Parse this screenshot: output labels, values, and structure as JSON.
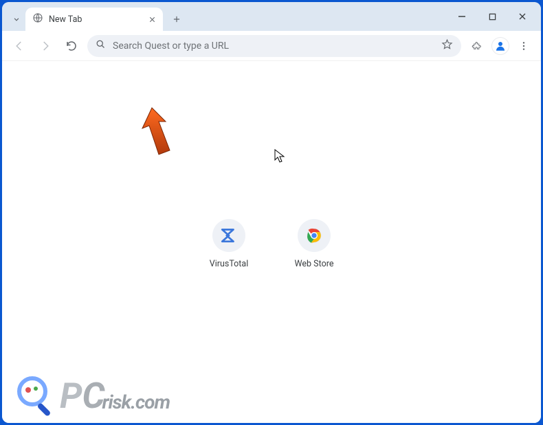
{
  "tab": {
    "title": "New Tab"
  },
  "omnibox": {
    "placeholder": "Search Quest or type a URL"
  },
  "shortcuts": [
    {
      "label": "VirusTotal"
    },
    {
      "label": "Web Store"
    }
  ],
  "watermark": {
    "text": "risk.com"
  }
}
